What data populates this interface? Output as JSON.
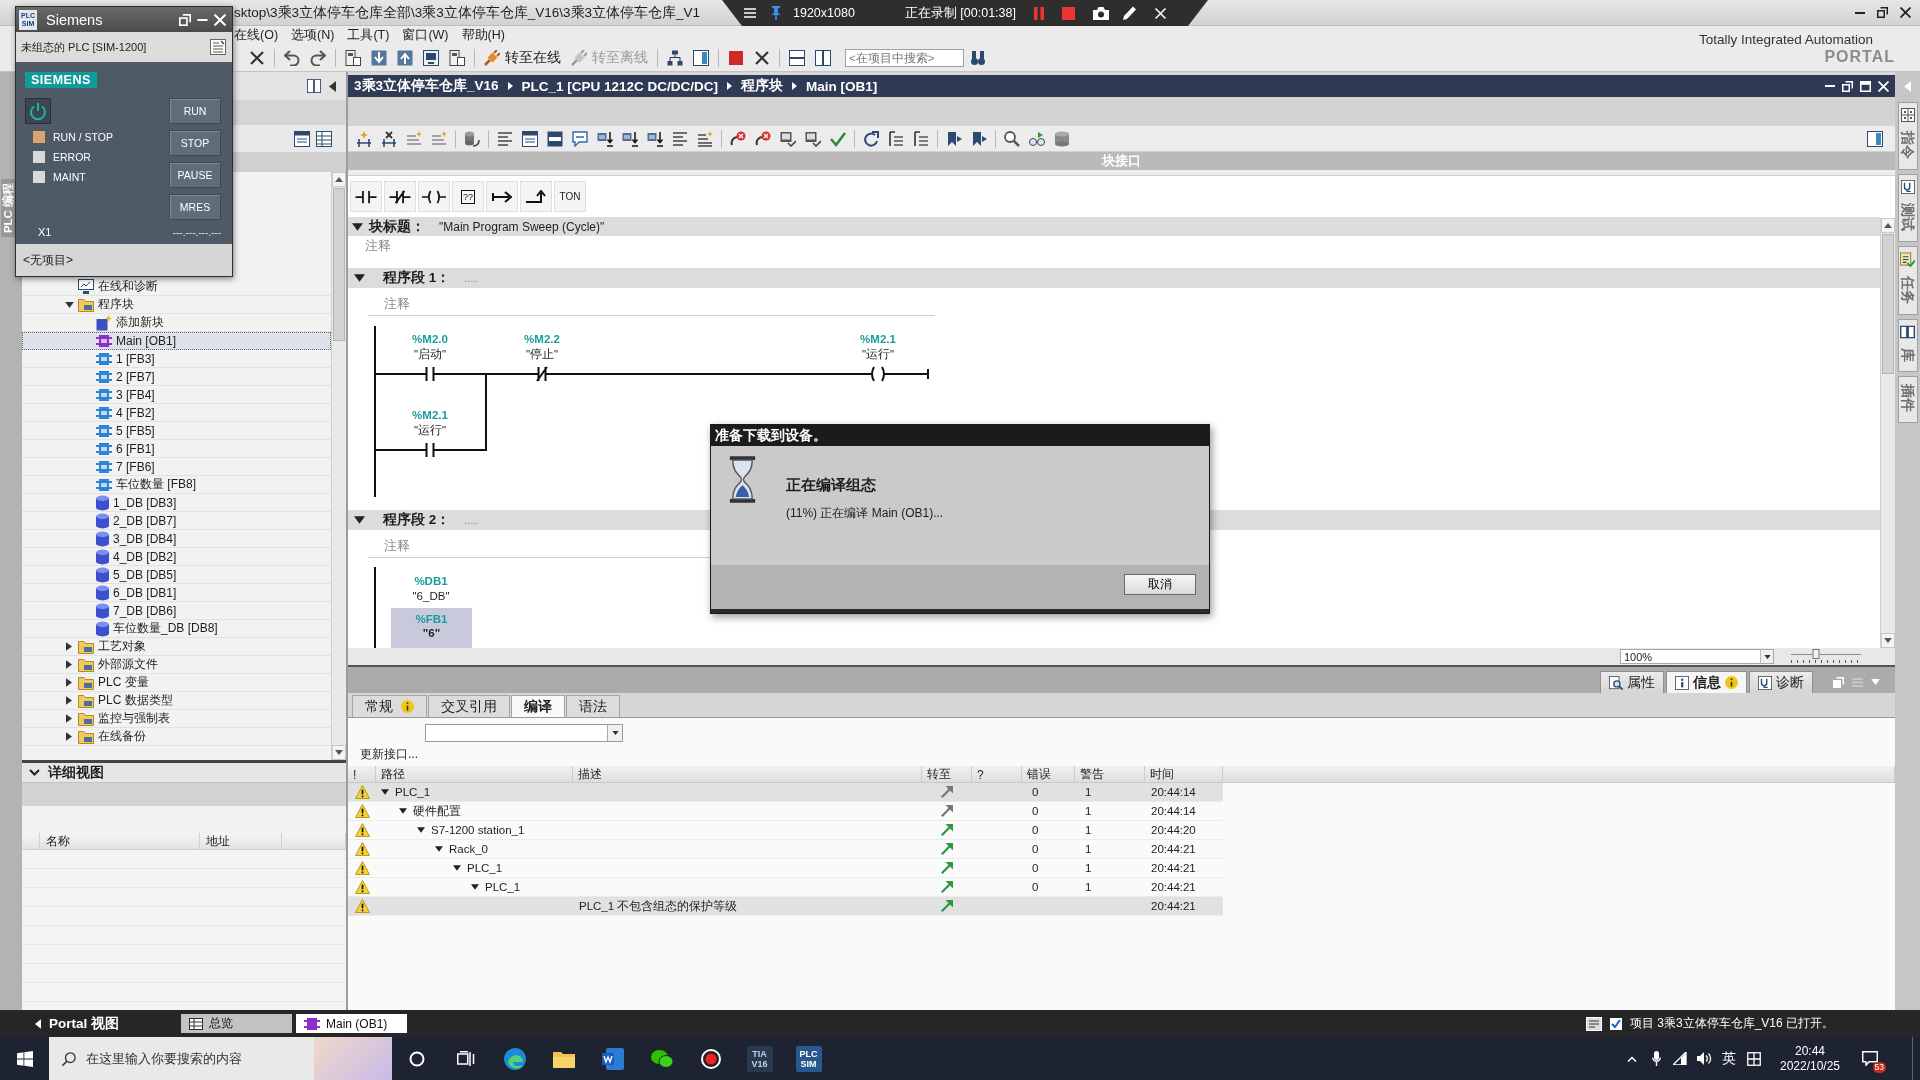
{
  "title_bar": {
    "title": "sktop\\3乘3立体停车仓库全部\\3乘3立体停车仓库_V16\\3乘3立体停车仓库_V1"
  },
  "recorder_bar": {
    "resolution": "1920x1080",
    "status": "正在录制 [00:01:38]"
  },
  "menu": [
    "在线(O)",
    "选项(N)",
    "工具(T)",
    "窗口(W)",
    "帮助(H)"
  ],
  "toolbar": {
    "buttons": [
      {
        "label": "转至在线",
        "disabled": false
      },
      {
        "label": "转至离线",
        "disabled": true
      }
    ],
    "search": {
      "placeholder": "<在项目中搜索>"
    }
  },
  "brand": {
    "line_1": "Totally Integrated Automation",
    "line_2": "PORTAL"
  },
  "side_strip": {
    "label": "PLC 编程"
  },
  "project_tree": {
    "items": [
      {
        "label": "在线和诊断",
        "kind": "diagnostics",
        "selected": false
      },
      {
        "label": "程序块",
        "kind": "folder",
        "expanded": true,
        "selected": false,
        "children": [
          {
            "label": "添加新块",
            "kind": "add",
            "selected": false
          },
          {
            "label": "Main [OB1]",
            "kind": "ob",
            "selected": true
          },
          {
            "label": "1 [FB3]",
            "kind": "fb",
            "selected": false
          },
          {
            "label": "2 [FB7]",
            "kind": "fb",
            "selected": false
          },
          {
            "label": "3 [FB4]",
            "kind": "fb",
            "selected": false
          },
          {
            "label": "4 [FB2]",
            "kind": "fb",
            "selected": false
          },
          {
            "label": "5 [FB5]",
            "kind": "fb",
            "selected": false
          },
          {
            "label": "6 [FB1]",
            "kind": "fb",
            "selected": false
          },
          {
            "label": "7 [FB6]",
            "kind": "fb",
            "selected": false
          },
          {
            "label": "车位数量 [FB8]",
            "kind": "fb",
            "selected": false
          },
          {
            "label": "1_DB [DB3]",
            "kind": "db",
            "selected": false
          },
          {
            "label": "2_DB [DB7]",
            "kind": "db",
            "selected": false
          },
          {
            "label": "3_DB [DB4]",
            "kind": "db",
            "selected": false
          },
          {
            "label": "4_DB [DB2]",
            "kind": "db",
            "selected": false
          },
          {
            "label": "5_DB [DB5]",
            "kind": "db",
            "selected": false
          },
          {
            "label": "6_DB [DB1]",
            "kind": "db",
            "selected": false
          },
          {
            "label": "7_DB [DB6]",
            "kind": "db",
            "selected": false
          },
          {
            "label": "车位数量_DB [DB8]",
            "kind": "db",
            "selected": false
          }
        ]
      },
      {
        "label": "工艺对象",
        "kind": "folder",
        "expanded": false,
        "selected": false
      },
      {
        "label": "外部源文件",
        "kind": "folder",
        "expanded": false,
        "selected": false
      },
      {
        "label": "PLC 变量",
        "kind": "folder",
        "expanded": false,
        "selected": false
      },
      {
        "label": "PLC 数据类型",
        "kind": "folder",
        "expanded": false,
        "selected": false
      },
      {
        "label": "监控与强制表",
        "kind": "folder",
        "expanded": false,
        "selected": false
      },
      {
        "label": "在线备份",
        "kind": "folder",
        "expanded": false,
        "selected": false
      }
    ]
  },
  "details_view": {
    "title": "详细视图",
    "expanded": true,
    "columns": [
      "名称",
      "地址"
    ]
  },
  "editor": {
    "breadcrumb": [
      "3乘3立体停车仓库_V16",
      "PLC_1 [CPU 1212C DC/DC/DC]",
      "程序块",
      "Main [OB1]"
    ],
    "interface_bar": "块接口",
    "instruction_bar": {
      "box_label": "??",
      "timer_label": "TON"
    },
    "block_title": {
      "label": "块标题：",
      "value": "\"Main Program Sweep (Cycle)\"",
      "expanded": true,
      "comment_placeholder": "注释"
    },
    "networks": [
      {
        "title": "程序段 1：",
        "title_placeholder": ".....",
        "expanded": true,
        "comment_placeholder": "注释",
        "kind": "contacts",
        "series": [
          {
            "kind": "no_contact",
            "address": "%M2.0",
            "symbol": "\"启动\""
          },
          {
            "kind": "nc_contact",
            "address": "%M2.2",
            "symbol": "\"停止\""
          },
          {
            "kind": "coil",
            "address": "%M2.1",
            "symbol": "\"运行\""
          }
        ],
        "branch": [
          {
            "kind": "no_contact",
            "address": "%M2.1",
            "symbol": "\"运行\""
          }
        ]
      },
      {
        "title": "程序段 2：",
        "title_placeholder": ".....",
        "expanded": true,
        "comment_placeholder": "注释",
        "kind": "block_call",
        "instance": {
          "address": "%DB1",
          "symbol": "\"6_DB\""
        },
        "block": {
          "address": "%FB1",
          "symbol": "\"6\""
        }
      }
    ],
    "zoom": {
      "value": "100%"
    },
    "zoom_slider": {
      "level": 0.35
    }
  },
  "task_cards": [
    {
      "label": "指令",
      "kind": "instructions",
      "selected": false
    },
    {
      "label": "测试",
      "kind": "testing",
      "selected": false
    },
    {
      "label": "任务",
      "kind": "tasks",
      "selected": false
    },
    {
      "label": "库",
      "kind": "libraries",
      "selected": false
    },
    {
      "label": "插件",
      "kind": "addins",
      "selected": false
    }
  ],
  "inspector": {
    "tabs": [
      {
        "label": "属性",
        "kind": "properties",
        "selected": false,
        "badge": false
      },
      {
        "label": "信息",
        "kind": "info",
        "selected": true,
        "badge": true
      },
      {
        "label": "诊断",
        "kind": "diagnostics",
        "selected": false,
        "badge": false
      }
    ],
    "subtabs": [
      {
        "label": "常规",
        "selected": false,
        "badge": true
      },
      {
        "label": "交叉引用",
        "selected": false,
        "badge": false
      },
      {
        "label": "编译",
        "selected": true,
        "badge": false
      },
      {
        "label": "语法",
        "selected": false,
        "badge": false
      }
    ],
    "update_link": "更新接口...",
    "columns": [
      "!",
      "路径",
      "描述",
      "转至",
      "?",
      "错误",
      "警告",
      "时间"
    ],
    "messages": [
      {
        "path": "PLC_1",
        "goto_enabled": false,
        "errors": "0",
        "warnings": "1",
        "time": "20:44:14",
        "selected": true,
        "expanded": true,
        "children": [
          {
            "path": "硬件配置",
            "goto_enabled": false,
            "errors": "0",
            "warnings": "1",
            "time": "20:44:14",
            "selected": false,
            "expanded": true,
            "children": [
              {
                "path": "S7-1200 station_1",
                "goto_enabled": true,
                "errors": "0",
                "warnings": "1",
                "time": "20:44:20",
                "selected": false,
                "expanded": true,
                "children": [
                  {
                    "path": "Rack_0",
                    "goto_enabled": true,
                    "errors": "0",
                    "warnings": "1",
                    "time": "20:44:21",
                    "selected": false,
                    "expanded": true,
                    "children": [
                      {
                        "path": "PLC_1",
                        "goto_enabled": true,
                        "errors": "0",
                        "warnings": "1",
                        "time": "20:44:21",
                        "selected": false,
                        "expanded": true,
                        "children": [
                          {
                            "path": "PLC_1",
                            "goto_enabled": true,
                            "errors": "0",
                            "warnings": "1",
                            "time": "20:44:21",
                            "selected": false,
                            "expanded": true,
                            "children": [
                              {
                                "description": "PLC_1 不包含组态的保护等级",
                                "goto_enabled": true,
                                "time": "20:44:21",
                                "selected": true
                              }
                            ]
                          }
                        ]
                      }
                    ]
                  }
                ]
              }
            ]
          }
        ]
      }
    ]
  },
  "portal_bar": {
    "portal_view": "Portal 视图",
    "tabs": [
      {
        "label": "总览",
        "kind": "overview",
        "selected": false
      },
      {
        "label": "Main (OB1)",
        "kind": "block",
        "selected": true
      }
    ],
    "status": "项目 3乘3立体停车仓库_V16 已打开。"
  },
  "taskbar": {
    "search_placeholder": "在这里输入你要搜索的内容",
    "tia_logo": [
      "TIA",
      "V16"
    ],
    "plcsim_logo": [
      "PLC",
      "SIM"
    ],
    "ime": "英",
    "time": "20:44",
    "date": "2022/10/25",
    "notification_count": "53"
  },
  "plcsim": {
    "title": "Siemens",
    "logo": [
      "PLC",
      "SIM"
    ],
    "device": "未组态的 PLC [SIM-1200]",
    "brand": "SIEMENS",
    "indicators": [
      {
        "label": "RUN / STOP",
        "color": "#d8a36e"
      },
      {
        "label": "ERROR",
        "color": "#d9d9d9"
      },
      {
        "label": "MAINT",
        "color": "#d9d9d9"
      }
    ],
    "buttons": [
      "RUN",
      "STOP",
      "PAUSE",
      "MRES"
    ],
    "interface": "X1",
    "address": "---.---.---.---",
    "project": "<无项目>"
  },
  "dialog": {
    "title": "准备下载到设备。",
    "heading": "正在编译组态",
    "progress": "(11%) 正在编译 Main (OB1)...",
    "cancel": "取消"
  }
}
